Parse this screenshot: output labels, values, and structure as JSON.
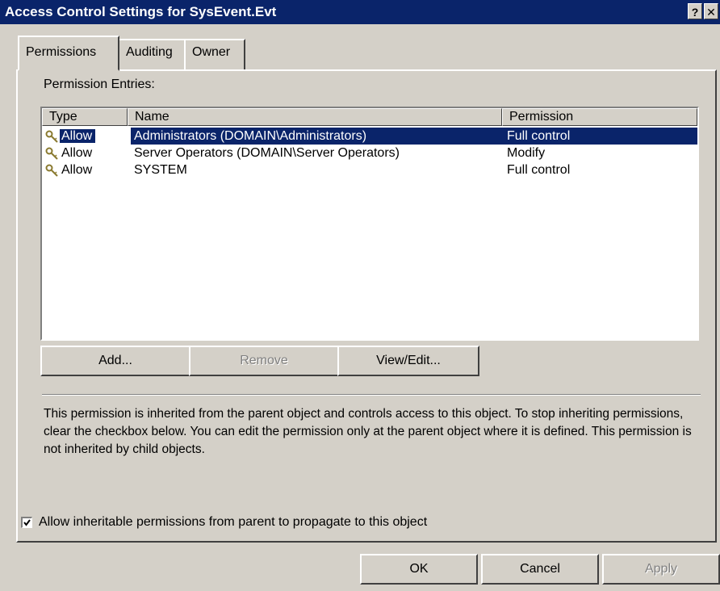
{
  "window": {
    "title": "Access Control Settings for SysEvent.Evt",
    "help_label": "?",
    "close_label": "✕"
  },
  "tabs": [
    {
      "label": "Permissions",
      "active": true
    },
    {
      "label": "Auditing",
      "active": false
    },
    {
      "label": "Owner",
      "active": false
    }
  ],
  "permissions": {
    "entries_label": "Permission Entries:",
    "columns": [
      "Type",
      "Name",
      "Permission"
    ],
    "rows": [
      {
        "type": "Allow",
        "name": "Administrators (DOMAIN\\Administrators)",
        "permission": "Full control",
        "selected": true
      },
      {
        "type": "Allow",
        "name": "Server Operators (DOMAIN\\Server Operators)",
        "permission": "Modify",
        "selected": false
      },
      {
        "type": "Allow",
        "name": "SYSTEM",
        "permission": "Full control",
        "selected": false
      }
    ],
    "buttons": {
      "add": "Add...",
      "remove": "Remove",
      "view_edit": "View/Edit..."
    },
    "description": "This permission is inherited from the parent object and controls access to this object.  To stop inheriting permissions, clear the checkbox below.  You can edit the permission only at the parent object where it is defined.  This permission is not inherited by child objects.",
    "inherit_checkbox": {
      "label": "Allow inheritable permissions from parent to propagate to this object",
      "checked": true
    }
  },
  "dialog_buttons": {
    "ok": "OK",
    "cancel": "Cancel",
    "apply": "Apply"
  },
  "colors": {
    "titlebar": "#0a246a",
    "face": "#d4d0c8",
    "selection": "#0a246a"
  }
}
